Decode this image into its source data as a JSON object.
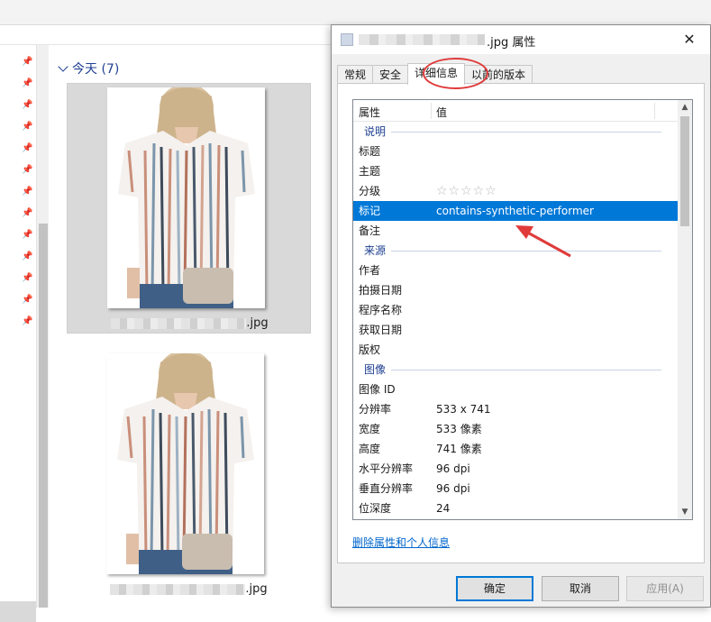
{
  "explorer": {
    "group_header": "今天 (7)",
    "files": [
      {
        "extension": ".jpg",
        "selected": true
      },
      {
        "extension": ".jpg",
        "selected": false
      }
    ]
  },
  "dialog": {
    "title_suffix": ".jpg 属性",
    "close_glyph": "✕",
    "tabs": [
      {
        "label": "常规",
        "active": false
      },
      {
        "label": "安全",
        "active": false
      },
      {
        "label": "详细信息",
        "active": true
      },
      {
        "label": "以前的版本",
        "active": false
      }
    ],
    "list_header": {
      "property": "属性",
      "value": "值"
    },
    "rows": [
      {
        "type": "section",
        "key": "说明"
      },
      {
        "type": "row",
        "key": "标题",
        "value": ""
      },
      {
        "type": "row",
        "key": "主题",
        "value": ""
      },
      {
        "type": "row",
        "key": "分级",
        "value": "☆☆☆☆☆",
        "rating": 0
      },
      {
        "type": "row",
        "key": "标记",
        "value": "contains-synthetic-performer",
        "selected": true
      },
      {
        "type": "row",
        "key": "备注",
        "value": ""
      },
      {
        "type": "section",
        "key": "来源"
      },
      {
        "type": "row",
        "key": "作者",
        "value": ""
      },
      {
        "type": "row",
        "key": "拍摄日期",
        "value": ""
      },
      {
        "type": "row",
        "key": "程序名称",
        "value": ""
      },
      {
        "type": "row",
        "key": "获取日期",
        "value": ""
      },
      {
        "type": "row",
        "key": "版权",
        "value": ""
      },
      {
        "type": "section",
        "key": "图像"
      },
      {
        "type": "row",
        "key": "图像 ID",
        "value": ""
      },
      {
        "type": "row",
        "key": "分辨率",
        "value": "533 x 741"
      },
      {
        "type": "row",
        "key": "宽度",
        "value": "533 像素"
      },
      {
        "type": "row",
        "key": "高度",
        "value": "741 像素"
      },
      {
        "type": "row",
        "key": "水平分辨率",
        "value": "96 dpi"
      },
      {
        "type": "row",
        "key": "垂直分辨率",
        "value": "96 dpi"
      },
      {
        "type": "row",
        "key": "位深度",
        "value": "24"
      }
    ],
    "remove_link": "删除属性和个人信息",
    "buttons": {
      "ok": "确定",
      "cancel": "取消",
      "apply": "应用(A)"
    }
  },
  "colors": {
    "selection": "#0078d7",
    "annotation": "#e03a3a",
    "link": "#0066cc",
    "group_header": "#1e3f91"
  }
}
